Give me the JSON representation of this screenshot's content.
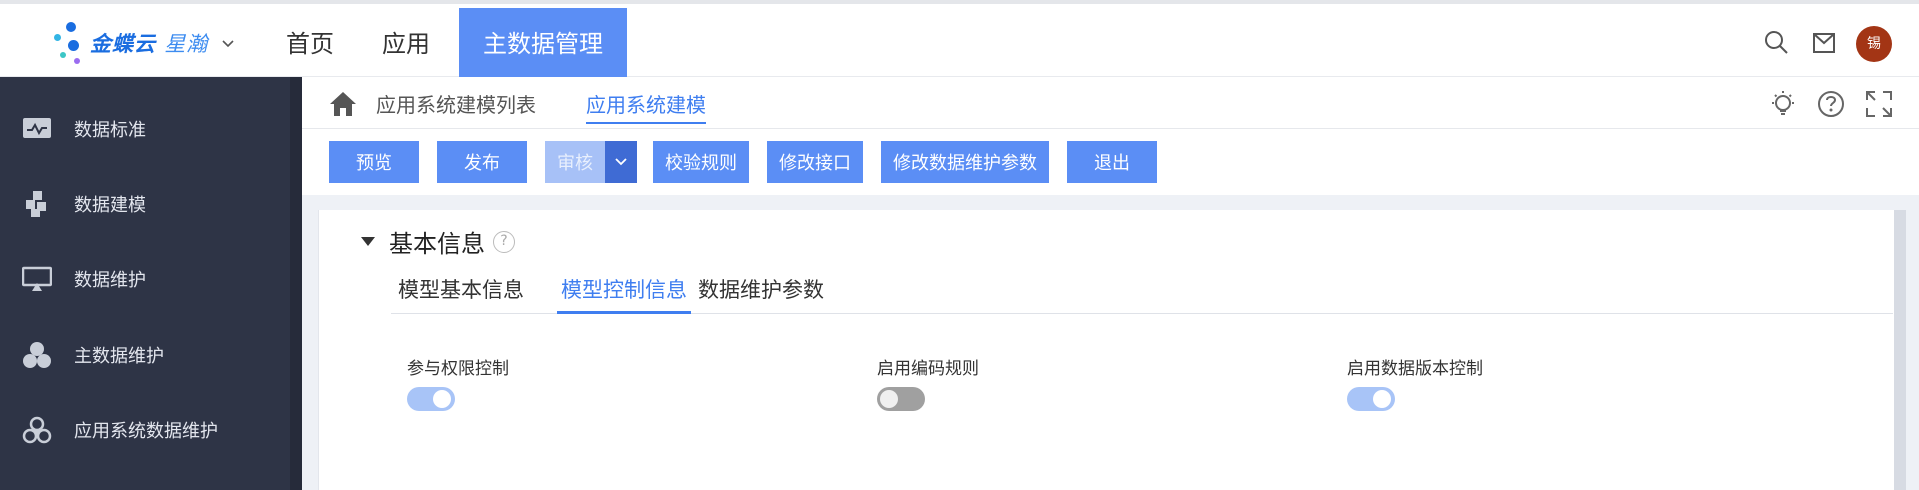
{
  "brand": {
    "name_bold": "金蝶云",
    "name_light": "星瀚",
    "colors": {
      "primary": "#5b8ef5",
      "sidebar": "#2e3446",
      "link": "#3f7ef0"
    }
  },
  "topnav": {
    "items": [
      {
        "label": "首页"
      },
      {
        "label": "应用"
      },
      {
        "label": "主数据管理",
        "active": true
      }
    ]
  },
  "header_icons": [
    "search-icon",
    "mail-icon",
    "avatar"
  ],
  "user": {
    "avatar_text": "锡"
  },
  "sidebar": {
    "items": [
      {
        "label": "数据标准",
        "icon": "data-standard-icon"
      },
      {
        "label": "数据建模",
        "icon": "data-modeling-icon"
      },
      {
        "label": "数据维护",
        "icon": "data-maintenance-icon"
      },
      {
        "label": "主数据维护",
        "icon": "master-data-icon"
      },
      {
        "label": "应用系统数据维护",
        "icon": "app-system-data-icon"
      }
    ]
  },
  "breadcrumb": {
    "items": [
      {
        "label": "应用系统建模列表"
      },
      {
        "label": "应用系统建模",
        "active": true
      }
    ],
    "icons": [
      "bulb-icon",
      "help-icon",
      "fullscreen-icon"
    ]
  },
  "toolbar": {
    "buttons": [
      {
        "label": "预览"
      },
      {
        "label": "发布"
      },
      {
        "label": "审核",
        "disabled": true
      },
      {
        "label": "校验规则"
      },
      {
        "label": "修改接口"
      },
      {
        "label": "修改数据维护参数"
      },
      {
        "label": "退出"
      }
    ]
  },
  "section": {
    "title": "基本信息",
    "help_glyph": "?",
    "tabs": [
      {
        "label": "模型基本信息"
      },
      {
        "label": "模型控制信息",
        "active": true
      },
      {
        "label": "数据维护参数"
      }
    ],
    "fields": [
      {
        "label": "参与权限控制",
        "enabled": true
      },
      {
        "label": "启用编码规则",
        "enabled": false
      },
      {
        "label": "启用数据版本控制",
        "enabled": true
      }
    ]
  }
}
